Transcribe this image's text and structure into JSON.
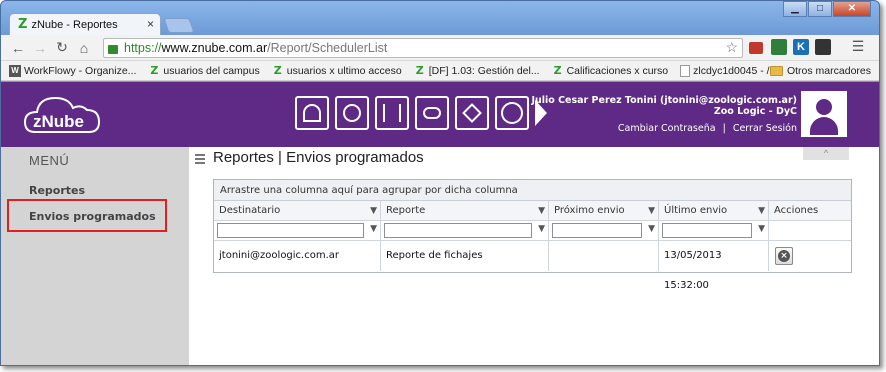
{
  "browser": {
    "tab_title": "zNube - Reportes",
    "tab_close": "×",
    "url_scheme": "https://",
    "url_host": "www.znube.com.ar",
    "url_path": "/Report/SchedulerList",
    "window_controls": [
      "▁",
      "□",
      "✕"
    ]
  },
  "bookmarks": {
    "items": [
      {
        "label": "WorkFlowy - Organize...",
        "icon": "workflowy-icon"
      },
      {
        "label": "usuarios del campus",
        "icon": "znube-icon"
      },
      {
        "label": "usuarios x ultimo acceso",
        "icon": "znube-icon"
      },
      {
        "label": "[DF] 1.03: Gestión del...",
        "icon": "znube-icon"
      },
      {
        "label": "Calificaciones x curso",
        "icon": "znube-icon"
      },
      {
        "label": "zlcdyc1d0045 - /",
        "icon": "document-icon"
      }
    ],
    "overflow": "»",
    "other": "Otros marcadores"
  },
  "header": {
    "brand": "zNube",
    "user_name": "Julio Cesar Perez Tonini (jtonini@zoologic.com.ar)",
    "company": "Zoo Logic - DyC",
    "change_password": "Cambiar Contraseña",
    "separator": "|",
    "logout": "Cerrar Sesión",
    "nav_icons": [
      "users-settings-icon",
      "user-sync-icon",
      "split-arrows-icon",
      "cloud-settings-icon",
      "cube-icon",
      "clock-icon"
    ],
    "accent": "#5f2a85"
  },
  "sidebar": {
    "title": "MENÚ",
    "items": [
      {
        "label": "Reportes"
      },
      {
        "label": "Envios programados"
      }
    ]
  },
  "main": {
    "title": "Reportes | Envios programados",
    "collapse": "^",
    "grid": {
      "group_hint": "Arrastre una columna aquí para agrupar por dicha columna",
      "columns": [
        "Destinatario",
        "Reporte",
        "Próximo envio",
        "Último envio",
        "Acciones"
      ],
      "rows": [
        {
          "destinatario": "jtonini@zoologic.com.ar",
          "reporte": "Reporte de fichajes",
          "proximo": "",
          "ultimo": "13/05/2013 15:32:00",
          "accion": "×"
        }
      ]
    }
  }
}
